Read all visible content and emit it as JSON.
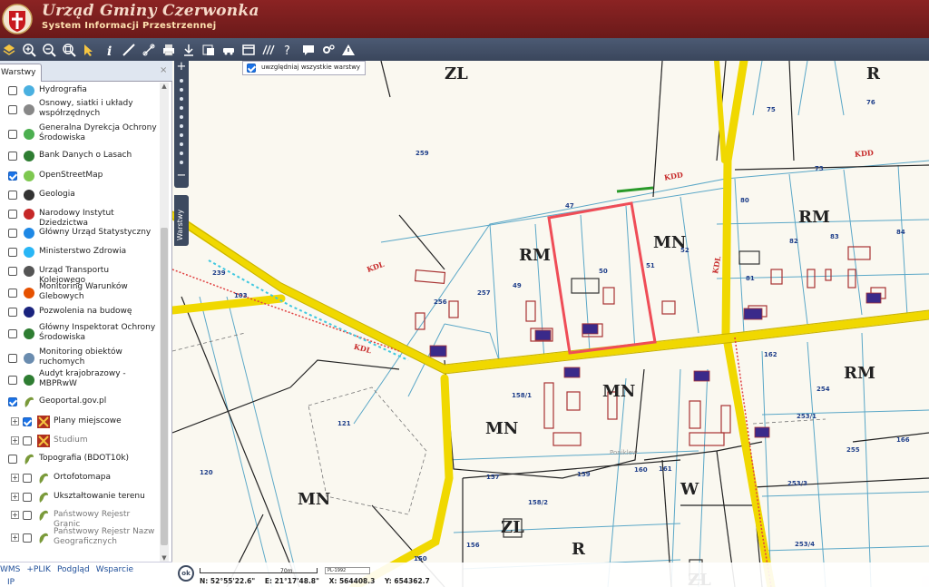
{
  "header": {
    "title": "Urząd Gminy Czerwonka",
    "subtitle": "System Informacji Przestrzennej"
  },
  "toolbar": {
    "buttons": [
      "layers-icon",
      "zoom-in-icon",
      "zoom-out-icon",
      "zoom-extent-icon",
      "pointer-icon",
      "info-icon",
      "measure-icon",
      "link-icon",
      "print-icon",
      "download-icon",
      "export-icon",
      "car-icon",
      "window-icon",
      "hatch-icon",
      "help-icon",
      "comment-icon",
      "settings-icon",
      "warning-icon"
    ]
  },
  "sidebar": {
    "tab_label": "Warstwy",
    "close": "×",
    "layers": [
      {
        "label": "Hydrografia",
        "checked": false,
        "expander": false,
        "icon": "water-icon",
        "dim": false
      },
      {
        "label": "Osnowy, siatki i układy współrzędnych",
        "checked": false,
        "expander": false,
        "icon": "globe-icon",
        "dim": false
      },
      {
        "label": "Generalna Dyrekcja Ochrony Środowiska",
        "checked": false,
        "expander": false,
        "icon": "leaf-icon",
        "dim": false
      },
      {
        "label": "Bank Danych o Lasach",
        "checked": false,
        "expander": false,
        "icon": "tree-icon",
        "dim": false
      },
      {
        "label": "OpenStreetMap",
        "checked": true,
        "expander": false,
        "icon": "osm-icon",
        "dim": false
      },
      {
        "label": "Geologia",
        "checked": false,
        "expander": false,
        "icon": "hammers-icon",
        "dim": false
      },
      {
        "label": "Narodowy Instytut Dziedzictwa",
        "checked": false,
        "expander": false,
        "icon": "heritage-icon",
        "dim": false
      },
      {
        "label": "Główny Urząd Statystyczny",
        "checked": false,
        "expander": false,
        "icon": "gus-icon",
        "dim": false
      },
      {
        "label": "Ministerstwo Zdrowia",
        "checked": false,
        "expander": false,
        "icon": "wave-icon",
        "dim": false
      },
      {
        "label": "Urząd Transportu Kolejowego",
        "checked": false,
        "expander": false,
        "icon": "rail-icon",
        "dim": false
      },
      {
        "label": "Monitoring Warunków Glebowych",
        "checked": false,
        "expander": false,
        "icon": "soil-icon",
        "dim": false
      },
      {
        "label": "Pozwolenia na budowę",
        "checked": false,
        "expander": false,
        "icon": "building-permit-icon",
        "dim": false
      },
      {
        "label": "Główny Inspektorat Ochrony Środowiska",
        "checked": false,
        "expander": false,
        "icon": "gios-icon",
        "dim": false
      },
      {
        "label": "Monitoring obiektów ruchomych",
        "checked": false,
        "expander": false,
        "icon": "satellite-icon",
        "dim": false
      },
      {
        "label": "Audyt krajobrazowy - MBPRwW",
        "checked": false,
        "expander": false,
        "icon": "landscape-icon",
        "dim": false
      },
      {
        "label": "Geoportal.gov.pl",
        "checked": true,
        "expander": false,
        "icon": "geoportal-icon",
        "dim": false
      },
      {
        "label": "Plany miejscowe",
        "checked": true,
        "expander": true,
        "icon": "plan-icon",
        "dim": false
      },
      {
        "label": "Studium",
        "checked": false,
        "expander": true,
        "icon": "plan-icon",
        "dim": true
      },
      {
        "label": "Topografia (BDOT10k)",
        "checked": false,
        "expander": false,
        "icon": "geoportal-icon",
        "dim": false
      },
      {
        "label": "Ortofotomapa",
        "checked": false,
        "expander": true,
        "icon": "geoportal-icon",
        "dim": false
      },
      {
        "label": "Ukształtowanie terenu",
        "checked": false,
        "expander": true,
        "icon": "geoportal-icon",
        "dim": false
      },
      {
        "label": "Państwowy Rejestr Granic",
        "checked": false,
        "expander": true,
        "icon": "geoportal-icon",
        "dim": true
      },
      {
        "label": "Państwowy Rejestr Nazw Geograficznych",
        "checked": false,
        "expander": true,
        "icon": "geoportal-icon",
        "dim": true
      }
    ],
    "footer_links": [
      "WMS",
      "+PLIK",
      "Podgląd",
      "Wsparcie"
    ],
    "footer_ip": "IP"
  },
  "map": {
    "layer_toggle_label": "uwzględniaj wszystkie warstwy",
    "side_tab_label": "Warstwy",
    "zoom_in": "+",
    "zoom_out": "−",
    "zone_labels": [
      "ZL",
      "R",
      "RM",
      "MN",
      "RM",
      "RM",
      "MN",
      "MN",
      "MN",
      "W",
      "ZL",
      "R",
      "ZL"
    ],
    "parcel_numbers": [
      "75",
      "76",
      "259",
      "239",
      "103",
      "256",
      "257",
      "49",
      "50",
      "51",
      "52",
      "80",
      "82",
      "83",
      "84",
      "81",
      "162",
      "254",
      "253/1",
      "255",
      "166",
      "158/1",
      "121",
      "157",
      "159",
      "160",
      "161",
      "120",
      "158/2",
      "156",
      "150",
      "253/3",
      "253/4",
      "73",
      "47"
    ],
    "road_labels": [
      "KDD",
      "KDD",
      "KDL",
      "KDL",
      "KDL"
    ],
    "place_label": "Poniklew"
  },
  "statusbar": {
    "ok_label": "ok",
    "scale_label": "70m",
    "crs": "PL-1992",
    "coords": [
      "N: 52°55'22.6\"",
      "E: 21°17'48.8\"",
      "X: 564408.3",
      "Y: 654362.7"
    ]
  }
}
